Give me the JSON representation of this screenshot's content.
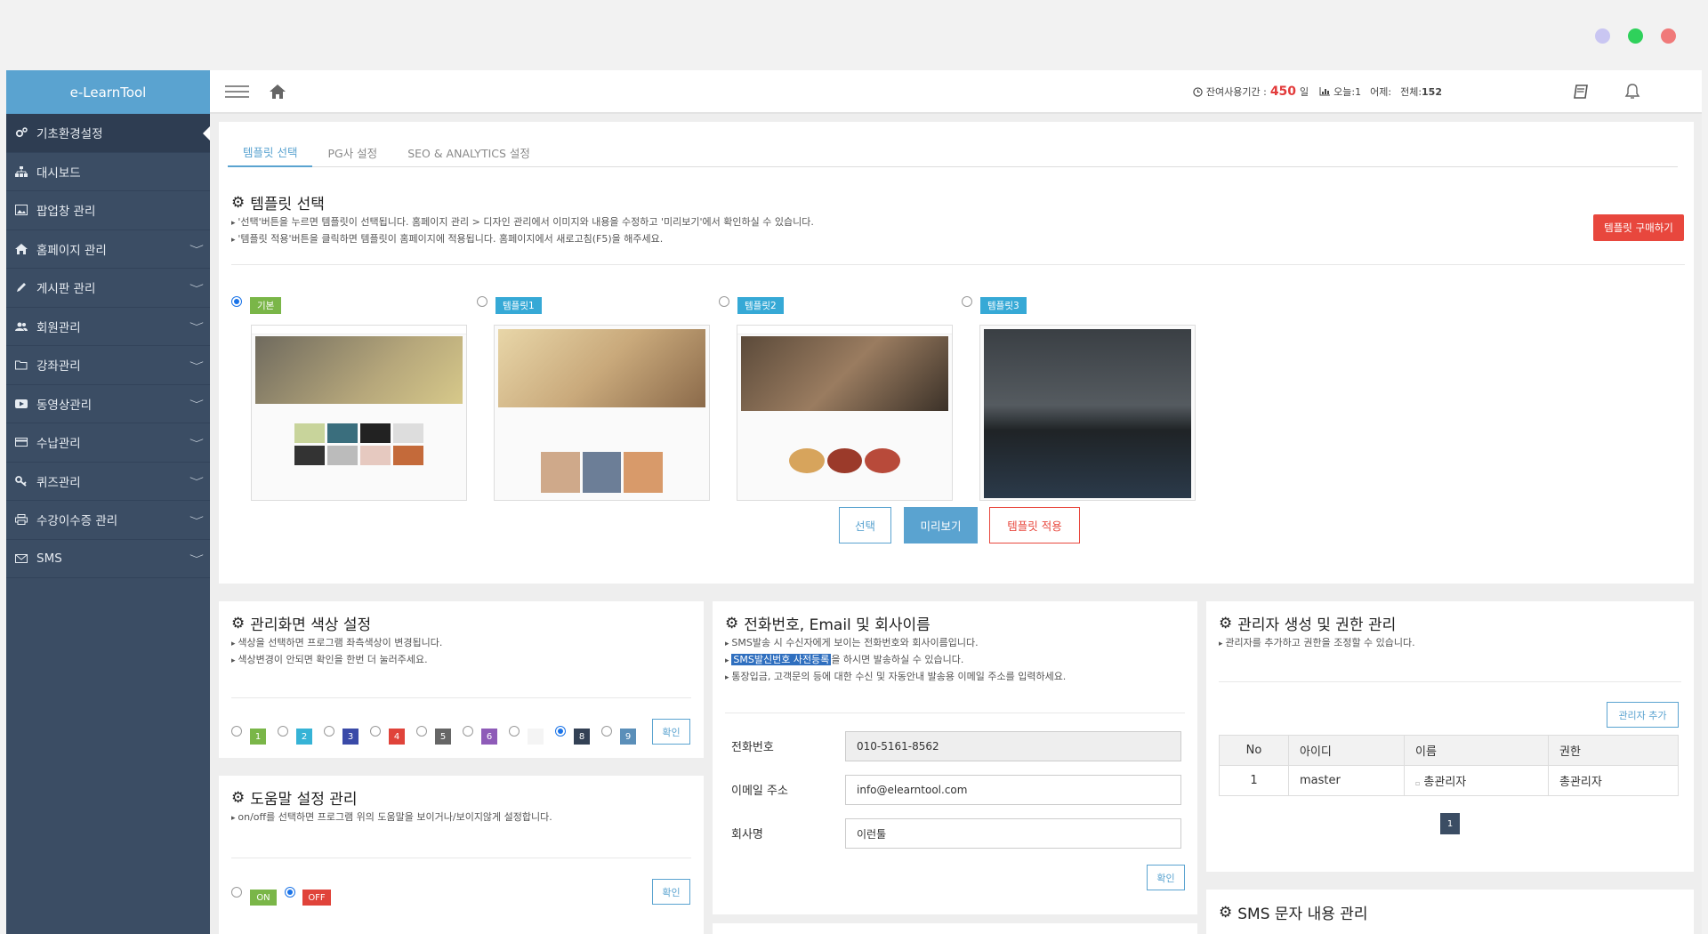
{
  "window_dots": [
    "#c9c6f2",
    "#2fd15b",
    "#f07a7a"
  ],
  "sidebar": {
    "brand": "e-LearnTool",
    "items": [
      {
        "label": "기초환경설정",
        "icon": "gears-icon",
        "active": true
      },
      {
        "label": "대시보드",
        "icon": "sitemap-icon"
      },
      {
        "label": "팝업창 관리",
        "icon": "image-icon"
      },
      {
        "label": "홈페이지 관리",
        "icon": "home-icon",
        "chevron": "﹀"
      },
      {
        "label": "게시판 관리",
        "icon": "pencil-icon",
        "chevron": "﹀"
      },
      {
        "label": "회원관리",
        "icon": "users-icon",
        "chevron": "﹀"
      },
      {
        "label": "강좌관리",
        "icon": "folder-icon",
        "chevron": "﹀"
      },
      {
        "label": "동영상관리",
        "icon": "video-icon",
        "chevron": "﹀"
      },
      {
        "label": "수납관리",
        "icon": "card-icon",
        "chevron": "﹀"
      },
      {
        "label": "퀴즈관리",
        "icon": "key-icon",
        "chevron": "﹀"
      },
      {
        "label": "수강이수증 관리",
        "icon": "printer-icon",
        "chevron": "﹀"
      },
      {
        "label": "SMS",
        "icon": "mail-icon",
        "chevron": "﹀"
      }
    ]
  },
  "topbar": {
    "period_label": "잔여사용기간 :",
    "period_value": "450",
    "period_unit": "일",
    "today": "오늘:1",
    "yesterday": "어제:",
    "total_label": "전체:",
    "total_value": "152"
  },
  "tabs": [
    "템플릿 선택",
    "PG사 설정",
    "SEO & ANALYTICS 설정"
  ],
  "template": {
    "title": "템플릿 선택",
    "desc": [
      "'선택'버튼을 누르면 템플릿이 선택됩니다. 홈페이지 관리 > 디자인 관리에서 이미지와 내용을 수정하고 '미리보기'에서 확인하실 수 있습니다.",
      "'템플릿 적용'버튼을 클릭하면 템플릿이 홈페이지에 적용됩니다. 홈페이지에서 새로고침(F5)을 해주세요."
    ],
    "buy_button": "템플릿 구매하기",
    "options": [
      {
        "label": "기본",
        "color": "#7ab648",
        "selected": true
      },
      {
        "label": "템플릿1",
        "color": "#36a9d6"
      },
      {
        "label": "템플릿2",
        "color": "#36a9d6"
      },
      {
        "label": "템플릿3",
        "color": "#36a9d6"
      }
    ],
    "buttons": {
      "select": "선택",
      "preview": "미리보기",
      "apply": "템플릿 적용"
    }
  },
  "color_panel": {
    "title": "관리화면 색상 설정",
    "desc": [
      "색상을 선택하면 프로그램 좌측색상이 변경됩니다.",
      "색상변경이 안되면 확인을 한번 더 눌러주세요."
    ],
    "swatches": [
      {
        "n": "1",
        "c": "#7ab648"
      },
      {
        "n": "2",
        "c": "#36b3d6"
      },
      {
        "n": "3",
        "c": "#3a4aa8"
      },
      {
        "n": "4",
        "c": "#e0433a"
      },
      {
        "n": "5",
        "c": "#666666"
      },
      {
        "n": "6",
        "c": "#8e5bb8"
      },
      {
        "n": "7",
        "c": "#f4f4f4"
      },
      {
        "n": "8",
        "c": "#334155"
      },
      {
        "n": "9",
        "c": "#5b8fb9"
      }
    ],
    "selected": "8",
    "confirm": "확인"
  },
  "help_panel": {
    "title": "도움말 설정 관리",
    "desc": [
      "on/off를 선택하면 프로그램 위의 도움말을 보이거나/보이지않게 설정합니다."
    ],
    "on": "ON",
    "off": "OFF",
    "selected": "OFF",
    "confirm": "확인"
  },
  "phone_panel": {
    "title": "전화번호, Email 및 회사이름",
    "desc1": "SMS발송 시 수신자에게 보이는 전화번호와 회사이름입니다.",
    "desc2_highlight": "SMS발신번호 사전등록",
    "desc2_rest": "을 하시면 발송하실 수 있습니다.",
    "desc3": "통장입금, 고객문의 등에 대한 수신 및 자동안내 발송용 이메일 주소를 입력하세요.",
    "fields": [
      {
        "label": "전화번호",
        "value": "010-5161-8562"
      },
      {
        "label": "이메일 주소",
        "value": "info@elearntool.com"
      },
      {
        "label": "회사명",
        "value": "이런툴"
      }
    ],
    "confirm": "확인"
  },
  "admin_panel": {
    "title": "관리자 생성 및 권한 관리",
    "desc": [
      "관리자를 추가하고 권한을 조정할 수 있습니다."
    ],
    "add": "관리자 추가",
    "columns": [
      "No",
      "아이디",
      "이름",
      "권한"
    ],
    "rows": [
      [
        "1",
        "master",
        "총관리자",
        "총관리자"
      ]
    ],
    "page": "1"
  },
  "sms_panel": {
    "title": "SMS 문자 내용 관리"
  }
}
